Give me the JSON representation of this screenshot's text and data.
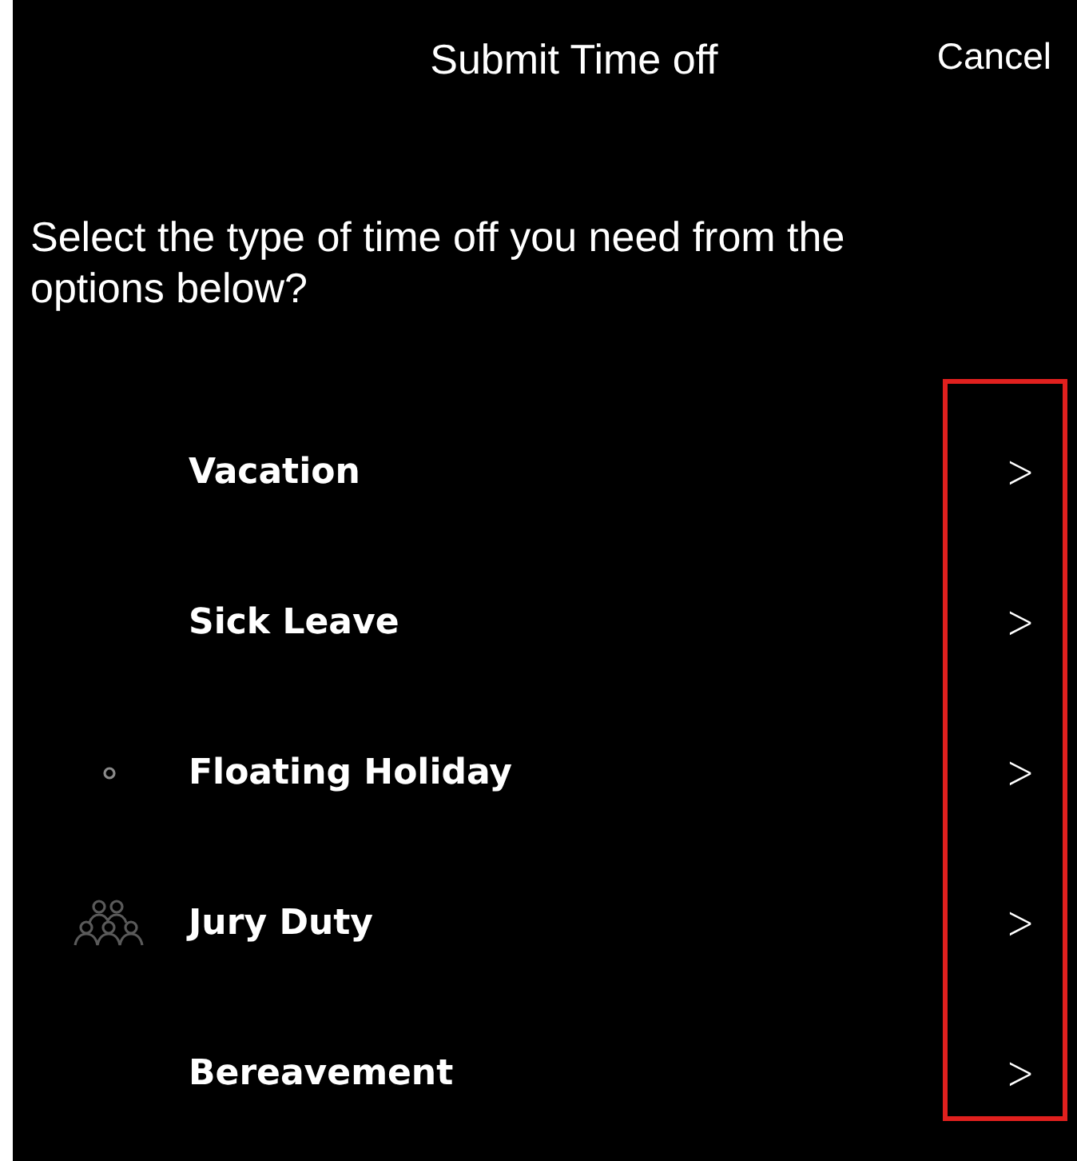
{
  "header": {
    "title": "Submit Time off",
    "cancel": "Cancel"
  },
  "prompt": "Select the type of time off you need from the options below?",
  "options": [
    {
      "label": "Vacation",
      "kind": "plain",
      "chevron": ">"
    },
    {
      "label": "Sick Leave",
      "kind": "plain",
      "chevron": ">"
    },
    {
      "label": "Floating Holiday",
      "kind": "dot",
      "chevron": ">"
    },
    {
      "label": "Jury Duty",
      "kind": "group",
      "chevron": ">"
    },
    {
      "label": "Bereavement",
      "kind": "plain",
      "chevron": ">"
    }
  ]
}
